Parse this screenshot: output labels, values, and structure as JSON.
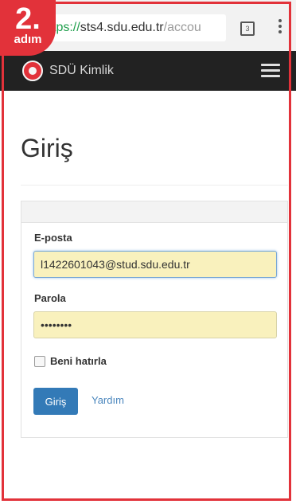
{
  "badge": {
    "number": "2.",
    "label": "adım"
  },
  "browser": {
    "url_scheme": "https",
    "url_separator": "://",
    "url_host": "sts4.sdu.edu.tr",
    "url_path": "/accou",
    "url_visible_scheme": "tps"
  },
  "navbar": {
    "brand": "SDÜ Kimlik"
  },
  "page": {
    "title": "Giriş"
  },
  "form": {
    "email_label": "E-posta",
    "email_value": "l1422601043@stud.sdu.edu.tr",
    "password_label": "Parola",
    "password_value": "secretpw",
    "remember_label": "Beni hatırla",
    "remember_checked": false,
    "login_button": "Giriş",
    "help_link": "Yardım"
  },
  "colors": {
    "frame": "#e2323a",
    "navbar": "#222222",
    "autofill": "#f9f1bd",
    "primary": "#337ab7",
    "link": "#4a86bd"
  },
  "icons": [
    "tab-switcher-icon",
    "overflow-menu-icon",
    "sdu-logo-icon",
    "hamburger-menu-icon"
  ]
}
